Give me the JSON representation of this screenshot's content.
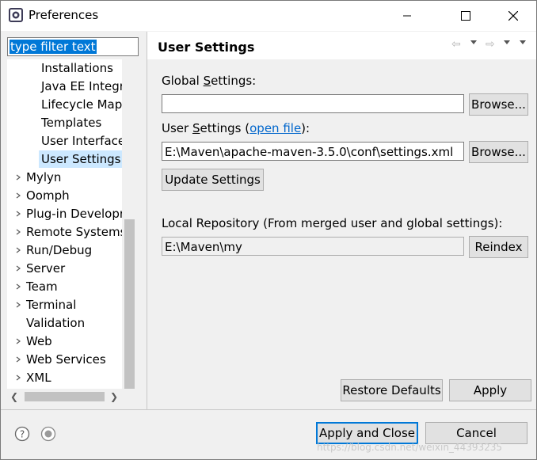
{
  "window": {
    "title": "Preferences"
  },
  "filter": {
    "text": "type filter text"
  },
  "tree": {
    "items": [
      {
        "label": "Installations",
        "indent": 1,
        "expandable": false,
        "selected": false
      },
      {
        "label": "Java EE Integra",
        "indent": 1,
        "expandable": false,
        "selected": false
      },
      {
        "label": "Lifecycle Mapp",
        "indent": 1,
        "expandable": false,
        "selected": false
      },
      {
        "label": "Templates",
        "indent": 1,
        "expandable": false,
        "selected": false
      },
      {
        "label": "User Interface",
        "indent": 1,
        "expandable": false,
        "selected": false
      },
      {
        "label": "User Settings",
        "indent": 1,
        "expandable": false,
        "selected": true
      },
      {
        "label": "Mylyn",
        "indent": 0,
        "expandable": true,
        "selected": false
      },
      {
        "label": "Oomph",
        "indent": 0,
        "expandable": true,
        "selected": false
      },
      {
        "label": "Plug-in Developr",
        "indent": 0,
        "expandable": true,
        "selected": false
      },
      {
        "label": "Remote Systems",
        "indent": 0,
        "expandable": true,
        "selected": false
      },
      {
        "label": "Run/Debug",
        "indent": 0,
        "expandable": true,
        "selected": false
      },
      {
        "label": "Server",
        "indent": 0,
        "expandable": true,
        "selected": false
      },
      {
        "label": "Team",
        "indent": 0,
        "expandable": true,
        "selected": false
      },
      {
        "label": "Terminal",
        "indent": 0,
        "expandable": true,
        "selected": false
      },
      {
        "label": "Validation",
        "indent": 0,
        "expandable": false,
        "selected": false
      },
      {
        "label": "Web",
        "indent": 0,
        "expandable": true,
        "selected": false
      },
      {
        "label": "Web Services",
        "indent": 0,
        "expandable": true,
        "selected": false
      },
      {
        "label": "XML",
        "indent": 0,
        "expandable": true,
        "selected": false
      }
    ]
  },
  "page": {
    "title": "User Settings",
    "global_label_pre": "Global ",
    "global_label_key": "S",
    "global_label_post": "ettings:",
    "global_value": "",
    "browse_label": "Browse...",
    "user_label_pre": "User ",
    "user_label_key": "S",
    "user_label_post": "ettings (",
    "open_file_link": "open file",
    "user_label_end": "):",
    "user_value": "E:\\Maven\\apache-maven-3.5.0\\conf\\settings.xml",
    "update_label": "Update Settings",
    "local_repo_label": "Local Repository (From merged user and global settings):",
    "local_repo_value": "E:\\Maven\\my",
    "reindex_label": "Reindex",
    "restore_label": "Restore Defaults",
    "apply_label": "Apply"
  },
  "footer": {
    "apply_close_label": "Apply and Close",
    "cancel_label": "Cancel",
    "watermark": "https://blog.csdn.net/weixin_44393235"
  },
  "colors": {
    "selection": "#0078d7",
    "tree_selection": "#cce8ff",
    "link": "#0066cc"
  }
}
